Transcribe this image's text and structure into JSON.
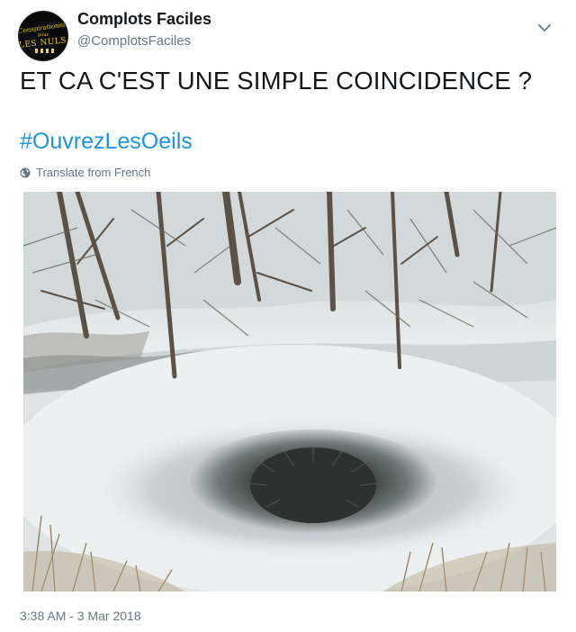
{
  "account": {
    "display_name": "Complots Faciles",
    "handle": "@ComplotsFaciles",
    "avatar_text_top": "La Conspirationnisme",
    "avatar_text_mid": "pour",
    "avatar_text_bottom": "LES NULS"
  },
  "tweet": {
    "text": "ET CA C'EST UNE SIMPLE COINCIDENCE ?",
    "hashtag": "#OuvrezLesOeils",
    "translate_label": "Translate from French",
    "timestamp": "3:38 AM - 3 Mar 2018"
  },
  "icons": {
    "menu": "chevron-down-icon",
    "translate": "globe-icon"
  },
  "colors": {
    "link": "#1b95e0",
    "secondary_text": "#657786",
    "primary_text": "#14171a"
  }
}
